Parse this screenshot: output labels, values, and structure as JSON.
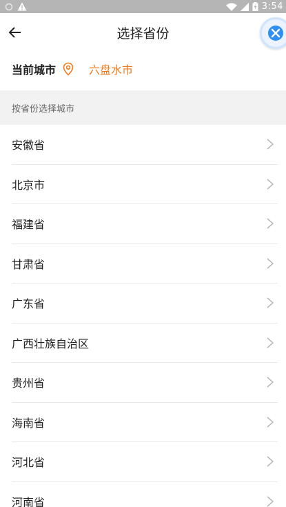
{
  "status_bar": {
    "time": "3:54"
  },
  "header": {
    "title": "选择省份"
  },
  "current": {
    "label": "当前城市",
    "city": "六盘水市"
  },
  "section": {
    "label": "按省份选择城市"
  },
  "provinces": [
    "安徽省",
    "北京市",
    "福建省",
    "甘肃省",
    "广东省",
    "广西壮族自治区",
    "贵州省",
    "海南省",
    "河北省",
    "河南省"
  ],
  "colors": {
    "accent": "#f07a1c",
    "statusbar": "#b5b5b5",
    "section_bg": "#f2f2f2",
    "float_icon": "#2e8ef5"
  }
}
